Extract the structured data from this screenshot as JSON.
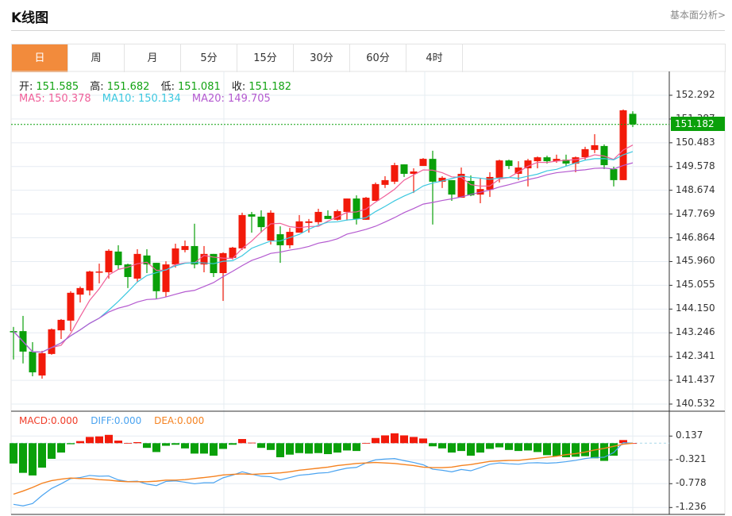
{
  "header": {
    "title": "K线图",
    "fundamental_link": "基本面分析>"
  },
  "tabs": [
    {
      "label": "日",
      "active": true
    },
    {
      "label": "周"
    },
    {
      "label": "月"
    },
    {
      "label": "5分"
    },
    {
      "label": "15分"
    },
    {
      "label": "30分"
    },
    {
      "label": "60分"
    },
    {
      "label": "4时"
    }
  ],
  "legend": {
    "open_label": "开:",
    "open": "151.585",
    "high_label": "高:",
    "high": "151.682",
    "low_label": "低:",
    "low": "151.081",
    "close_label": "收:",
    "close": "151.182",
    "ma5": "MA5: 150.378",
    "ma10": "MA10: 150.134",
    "ma20": "MA20: 149.705"
  },
  "macd_legend": {
    "macd": "MACD:0.000",
    "diff": "DIFF:0.000",
    "dea": "DEA:0.000"
  },
  "current_price": "151.182",
  "colors": {
    "up": "#f21a0a",
    "down": "#0aa00a",
    "ma5": "#f0609a",
    "ma10": "#3cc8e0",
    "ma20": "#b45ad0",
    "diff": "#4aa3f0",
    "dea": "#f58220",
    "accent": "#f28b3c"
  },
  "chart_data": [
    {
      "type": "candlestick",
      "y_ticks": [
        "152.292",
        "151.387",
        "150.483",
        "149.578",
        "148.674",
        "147.769",
        "146.864",
        "145.960",
        "145.055",
        "144.150",
        "143.246",
        "142.341",
        "141.437",
        "140.532"
      ],
      "ylim": [
        140.532,
        152.292
      ],
      "grid": true,
      "candles": [
        [
          143.31,
          143.47,
          142.23,
          143.3
        ],
        [
          143.31,
          143.89,
          142.08,
          142.53
        ],
        [
          142.53,
          142.89,
          141.59,
          141.74
        ],
        [
          141.62,
          142.56,
          141.5,
          142.47
        ],
        [
          142.44,
          143.41,
          142.41,
          143.38
        ],
        [
          143.34,
          143.77,
          143.01,
          143.74
        ],
        [
          143.71,
          144.83,
          143.31,
          144.77
        ],
        [
          144.7,
          145.01,
          144.4,
          144.95
        ],
        [
          144.86,
          145.61,
          144.67,
          145.58
        ],
        [
          145.55,
          145.88,
          145.13,
          145.58
        ],
        [
          145.55,
          146.43,
          145.31,
          146.37
        ],
        [
          146.34,
          146.58,
          145.67,
          145.82
        ],
        [
          145.85,
          145.88,
          144.95,
          145.37
        ],
        [
          145.31,
          146.43,
          145.19,
          146.25
        ],
        [
          146.19,
          146.43,
          145.52,
          145.85
        ],
        [
          145.91,
          145.91,
          144.55,
          144.83
        ],
        [
          144.8,
          145.97,
          144.61,
          145.85
        ],
        [
          145.85,
          146.64,
          145.73,
          146.46
        ],
        [
          146.4,
          146.76,
          146.31,
          146.55
        ],
        [
          146.55,
          147.4,
          145.7,
          145.85
        ],
        [
          145.85,
          146.55,
          145.55,
          146.25
        ],
        [
          146.25,
          146.25,
          145.37,
          145.52
        ],
        [
          145.52,
          146.31,
          144.46,
          146.28
        ],
        [
          146.1,
          146.52,
          146.04,
          146.49
        ],
        [
          146.46,
          147.82,
          146.4,
          147.73
        ],
        [
          147.76,
          147.85,
          147.06,
          147.67
        ],
        [
          147.67,
          147.91,
          147.06,
          147.27
        ],
        [
          146.76,
          147.91,
          146.61,
          147.82
        ],
        [
          147.0,
          147.3,
          145.91,
          146.58
        ],
        [
          146.58,
          147.24,
          146.46,
          147.09
        ],
        [
          147.06,
          147.73,
          147.06,
          147.49
        ],
        [
          147.43,
          147.58,
          147.06,
          147.49
        ],
        [
          147.46,
          147.97,
          147.37,
          147.85
        ],
        [
          147.7,
          147.91,
          147.58,
          147.58
        ],
        [
          147.55,
          147.94,
          147.52,
          147.88
        ],
        [
          147.85,
          148.36,
          147.52,
          148.36
        ],
        [
          148.36,
          148.48,
          147.37,
          147.58
        ],
        [
          147.55,
          148.42,
          147.55,
          148.39
        ],
        [
          148.27,
          148.97,
          148.27,
          148.91
        ],
        [
          148.88,
          149.21,
          148.76,
          149.06
        ],
        [
          149.0,
          149.72,
          148.91,
          149.63
        ],
        [
          149.66,
          149.66,
          149.18,
          149.3
        ],
        [
          149.3,
          149.51,
          148.57,
          149.39
        ],
        [
          149.6,
          149.9,
          149.6,
          149.87
        ],
        [
          149.87,
          150.18,
          147.37,
          149.0
        ],
        [
          149.0,
          149.21,
          148.76,
          149.15
        ],
        [
          149.06,
          149.06,
          148.27,
          148.51
        ],
        [
          148.39,
          149.54,
          148.39,
          149.3
        ],
        [
          149.03,
          149.24,
          148.45,
          148.48
        ],
        [
          148.51,
          149.12,
          148.18,
          148.72
        ],
        [
          148.69,
          149.36,
          148.42,
          149.18
        ],
        [
          149.15,
          149.84,
          148.97,
          149.81
        ],
        [
          149.81,
          149.84,
          149.48,
          149.6
        ],
        [
          149.3,
          149.78,
          149.06,
          149.54
        ],
        [
          149.51,
          149.87,
          148.82,
          149.81
        ],
        [
          149.78,
          149.96,
          149.51,
          149.93
        ],
        [
          149.93,
          149.99,
          149.69,
          149.78
        ],
        [
          149.78,
          150.03,
          149.72,
          149.87
        ],
        [
          149.84,
          150.03,
          149.6,
          149.69
        ],
        [
          149.69,
          149.96,
          149.36,
          149.93
        ],
        [
          149.93,
          150.33,
          149.84,
          150.24
        ],
        [
          150.21,
          150.81,
          150.09,
          150.39
        ],
        [
          150.36,
          150.42,
          149.48,
          149.63
        ],
        [
          149.48,
          149.57,
          148.82,
          149.06
        ],
        [
          149.06,
          151.75,
          149.06,
          151.72
        ],
        [
          151.585,
          151.682,
          151.081,
          151.182
        ]
      ],
      "series": [
        {
          "name": "MA5",
          "period": 5
        },
        {
          "name": "MA10",
          "period": 10
        },
        {
          "name": "MA20",
          "period": 20
        }
      ]
    },
    {
      "type": "macd",
      "y_ticks": [
        "0.137",
        "-0.321",
        "-0.778",
        "-1.236"
      ],
      "ylim": [
        -1.236,
        0.137
      ],
      "hist": [
        -0.39,
        -0.57,
        -0.62,
        -0.47,
        -0.3,
        -0.18,
        -0.02,
        0.04,
        0.12,
        0.13,
        0.16,
        0.05,
        0.005,
        0.02,
        -0.09,
        -0.17,
        -0.05,
        -0.03,
        -0.1,
        -0.2,
        -0.2,
        -0.24,
        -0.11,
        -0.03,
        0.08,
        0.01,
        -0.09,
        -0.13,
        -0.27,
        -0.22,
        -0.19,
        -0.2,
        -0.19,
        -0.21,
        -0.18,
        -0.14,
        -0.15,
        0.005,
        0.1,
        0.15,
        0.19,
        0.15,
        0.12,
        0.09,
        -0.06,
        -0.1,
        -0.18,
        -0.15,
        -0.24,
        -0.18,
        -0.11,
        -0.08,
        -0.13,
        -0.15,
        -0.14,
        -0.17,
        -0.23,
        -0.25,
        -0.27,
        -0.26,
        -0.25,
        -0.29,
        -0.34,
        -0.24,
        0.06,
        0.0
      ],
      "dea": [
        -0.98,
        -0.92,
        -0.85,
        -0.77,
        -0.72,
        -0.69,
        -0.67,
        -0.68,
        -0.68,
        -0.7,
        -0.71,
        -0.73,
        -0.74,
        -0.74,
        -0.74,
        -0.73,
        -0.71,
        -0.71,
        -0.7,
        -0.68,
        -0.66,
        -0.64,
        -0.61,
        -0.6,
        -0.59,
        -0.6,
        -0.59,
        -0.58,
        -0.57,
        -0.55,
        -0.52,
        -0.5,
        -0.48,
        -0.46,
        -0.43,
        -0.41,
        -0.39,
        -0.38,
        -0.37,
        -0.38,
        -0.39,
        -0.41,
        -0.43,
        -0.46,
        -0.47,
        -0.47,
        -0.46,
        -0.43,
        -0.41,
        -0.38,
        -0.35,
        -0.34,
        -0.33,
        -0.33,
        -0.31,
        -0.29,
        -0.27,
        -0.25,
        -0.22,
        -0.2,
        -0.17,
        -0.13,
        -0.1,
        -0.06,
        -0.02,
        0.0
      ]
    }
  ]
}
